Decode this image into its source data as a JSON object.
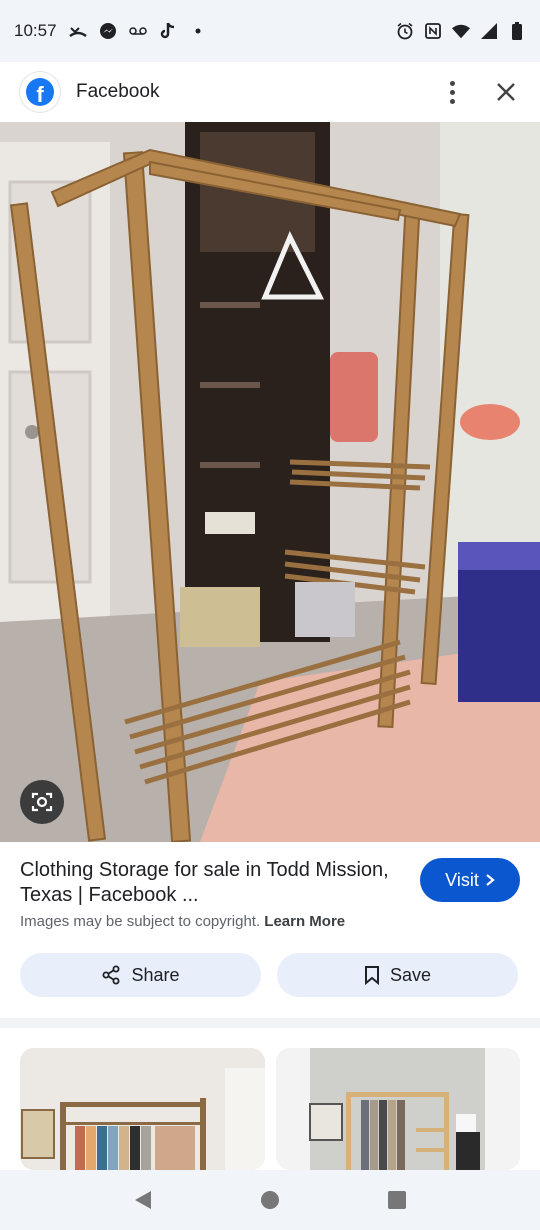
{
  "status_bar": {
    "time": "10:57",
    "left_icons": [
      "missed-call-icon",
      "messenger-icon",
      "voicemail-icon",
      "tiktok-icon",
      "dot-icon"
    ],
    "right_icons": [
      "alarm-icon",
      "nfc-icon",
      "wifi-icon",
      "signal-icon",
      "battery-icon"
    ]
  },
  "header": {
    "app_name": "Facebook",
    "logo_letter": "f"
  },
  "result": {
    "title": "Clothing Storage for sale in Todd Mission, Texas | Facebook ...",
    "visit_label": "Visit",
    "copyright_text": "Images may be subject to copyright.",
    "learn_more": "Learn More"
  },
  "actions": {
    "share_label": "Share",
    "save_label": "Save"
  },
  "colors": {
    "facebook_blue": "#1877f2",
    "visit_button": "#0b57d0",
    "action_button_bg": "#e8effb",
    "status_bar_bg": "#f1f4f9"
  }
}
